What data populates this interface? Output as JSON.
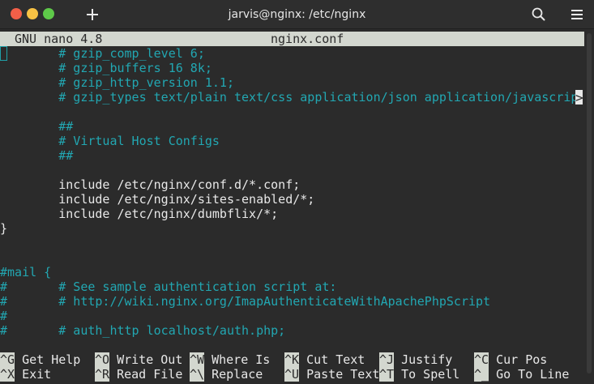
{
  "window": {
    "title": "jarvis@nginx: /etc/nginx"
  },
  "nano": {
    "version": "GNU nano 4.8",
    "filename": "nginx.conf",
    "overflow_marker": ">"
  },
  "lines": [
    {
      "text": "        # gzip_comp_level 6;",
      "kind": "comment"
    },
    {
      "text": "        # gzip_buffers 16 8k;",
      "kind": "comment"
    },
    {
      "text": "        # gzip_http_version 1.1;",
      "kind": "comment"
    },
    {
      "text": "        # gzip_types text/plain text/css application/json application/javascrip",
      "kind": "comment"
    },
    {
      "text": "",
      "kind": "text"
    },
    {
      "text": "        ##",
      "kind": "comment"
    },
    {
      "text": "        # Virtual Host Configs",
      "kind": "comment"
    },
    {
      "text": "        ##",
      "kind": "comment"
    },
    {
      "text": "",
      "kind": "text"
    },
    {
      "text": "        include /etc/nginx/conf.d/*.conf;",
      "kind": "text"
    },
    {
      "text": "        include /etc/nginx/sites-enabled/*;",
      "kind": "text"
    },
    {
      "text": "        include /etc/nginx/dumbflix/*;",
      "kind": "text"
    },
    {
      "text": "}",
      "kind": "text"
    },
    {
      "text": "",
      "kind": "text"
    },
    {
      "text": "",
      "kind": "text"
    },
    {
      "text": "#mail {",
      "kind": "comment"
    },
    {
      "text": "#       # See sample authentication script at:",
      "kind": "comment"
    },
    {
      "text": "#       # http://wiki.nginx.org/ImapAuthenticateWithApachePhpScript",
      "kind": "comment"
    },
    {
      "text": "#",
      "kind": "comment"
    },
    {
      "text": "#       # auth_http localhost/auth.php;",
      "kind": "comment"
    }
  ],
  "shortcuts": [
    {
      "key": "^G",
      "label": " Get Help"
    },
    {
      "key": "^O",
      "label": " Write Out"
    },
    {
      "key": "^W",
      "label": " Where Is"
    },
    {
      "key": "^K",
      "label": " Cut Text"
    },
    {
      "key": "^J",
      "label": " Justify"
    },
    {
      "key": "^C",
      "label": " Cur Pos"
    },
    {
      "key": "^X",
      "label": " Exit"
    },
    {
      "key": "^R",
      "label": " Read File"
    },
    {
      "key": "^\\",
      "label": " Replace"
    },
    {
      "key": "^U",
      "label": " Paste Text"
    },
    {
      "key": "^T",
      "label": " To Spell"
    },
    {
      "key": "^_",
      "label": " Go To Line"
    }
  ],
  "colors": {
    "comment": "#22a7b2",
    "text": "#e8e8e8",
    "bar": "#d3d7cf",
    "background": "#2b2b2b"
  },
  "icons": {
    "new_tab": "plus-icon",
    "search": "search-icon",
    "menu": "hamburger-menu-icon"
  }
}
